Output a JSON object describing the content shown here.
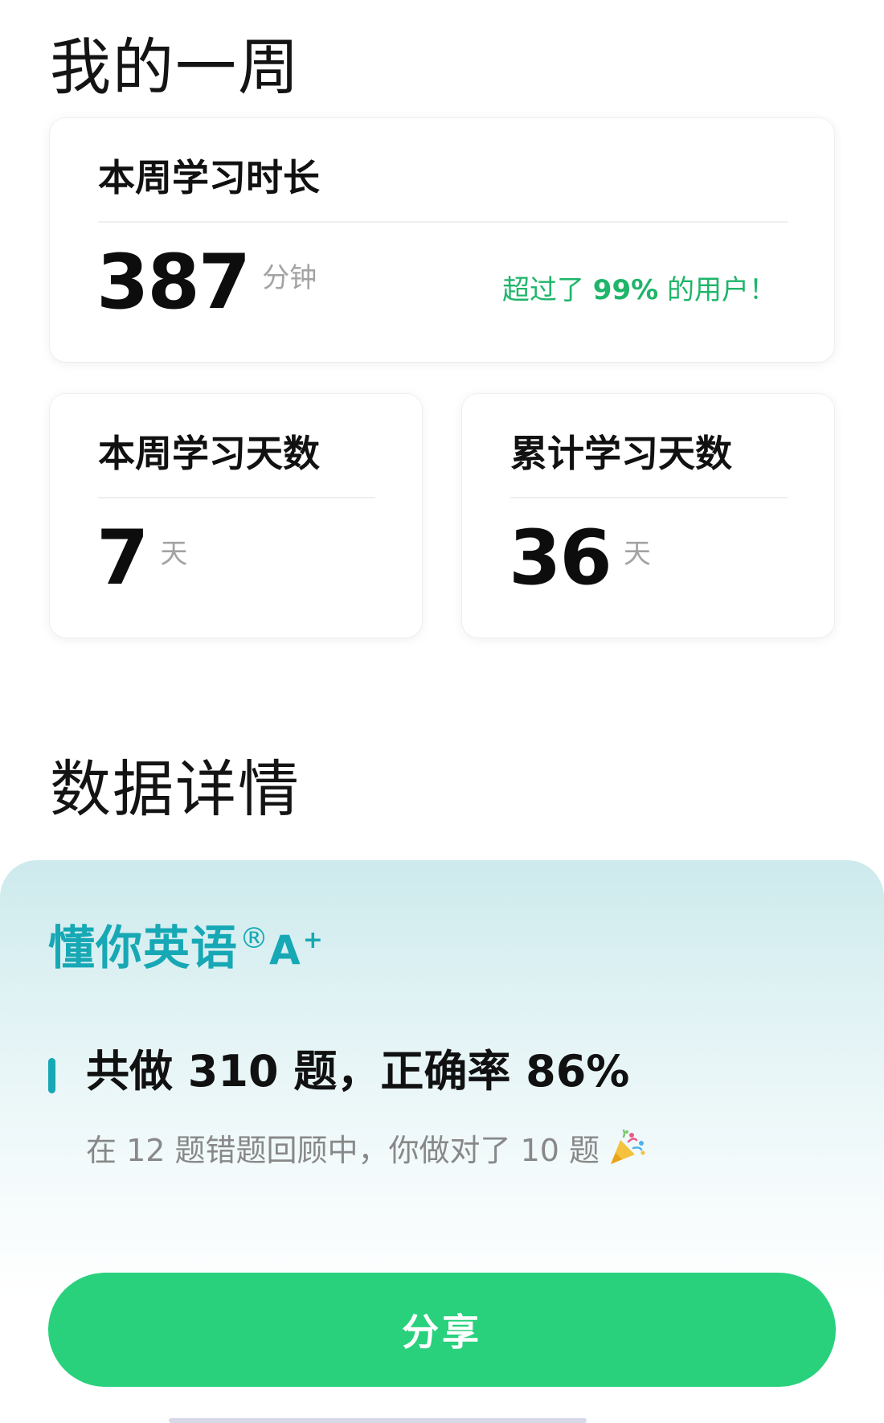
{
  "week_section": {
    "title": "我的一周"
  },
  "duration_card": {
    "label": "本周学习时长",
    "value": "387",
    "unit": "分钟",
    "note_prefix": "超过了 ",
    "note_percent": "99%",
    "note_suffix": " 的用户！"
  },
  "week_days_card": {
    "label": "本周学习天数",
    "value": "7",
    "unit": "天"
  },
  "total_days_card": {
    "label": "累计学习天数",
    "value": "36",
    "unit": "天"
  },
  "detail_section": {
    "title": "数据详情"
  },
  "course": {
    "brand": "懂你英语",
    "registered_mark": "®",
    "grade": "A",
    "grade_mark": "+",
    "summary": "共做 310 题，正确率 86%",
    "review_note": "在 12 题错题回顾中，你做对了 10 题"
  },
  "share_button": {
    "label": "分享"
  },
  "icons": {
    "party": "party-popper-icon"
  },
  "colors": {
    "accent_green": "#29d17d",
    "note_green": "#1fb56a",
    "brand_teal": "#17a8b5"
  }
}
